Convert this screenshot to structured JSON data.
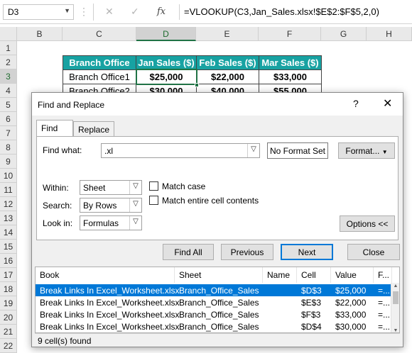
{
  "formula_bar": {
    "name_box": "D3",
    "formula": "=VLOOKUP(C3,Jan_Sales.xlsx!$E$2:$F$5,2,0)",
    "icons": [
      "more-options-icon",
      "cancel-icon",
      "confirm-icon",
      "function-icon"
    ]
  },
  "grid": {
    "columns": [
      "B",
      "C",
      "D",
      "E",
      "F",
      "G",
      "H"
    ],
    "rows": [
      "1",
      "2",
      "3",
      "4",
      "5",
      "6",
      "7",
      "8",
      "9",
      "10",
      "11",
      "12",
      "13",
      "14",
      "15",
      "16",
      "17",
      "18",
      "19",
      "20",
      "21",
      "22"
    ],
    "table": {
      "headers": [
        "Branch Office",
        "Jan Sales ($)",
        "Feb Sales ($)",
        "Mar Sales ($)"
      ],
      "rows": [
        [
          "Branch Office1",
          "$25,000",
          "$22,000",
          "$33,000"
        ],
        [
          "Branch Office2",
          "$30,000",
          "$40,000",
          "$55,000"
        ]
      ]
    },
    "colors": {
      "header_fill": "#17a2a2",
      "selection": "#217346"
    }
  },
  "dialog": {
    "title": "Find and Replace",
    "help": "?",
    "close": "✕",
    "tabs": [
      "Find",
      "Replace"
    ],
    "find_what_label": "Find what:",
    "find_what_value": ".xl",
    "no_format_label": "No Format Set",
    "format_label": "Format...",
    "within_label": "Within:",
    "within_value": "Sheet",
    "search_label": "Search:",
    "search_value": "By Rows",
    "look_in_label": "Look in:",
    "look_in_value": "Formulas",
    "match_case": "Match case",
    "match_entire": "Match entire cell contents",
    "options_label": "Options <<",
    "buttons": [
      "Find All",
      "Previous",
      "Next",
      "Close"
    ],
    "results": {
      "columns": [
        "Book",
        "Sheet",
        "Name",
        "Cell",
        "Value",
        "F..."
      ],
      "rows": [
        [
          "Break Links In Excel_Worksheet.xlsx",
          "Branch_Office_Sales",
          "",
          "$D$3",
          "$25,000",
          "=..."
        ],
        [
          "Break Links In Excel_Worksheet.xlsx",
          "Branch_Office_Sales",
          "",
          "$E$3",
          "$22,000",
          "=..."
        ],
        [
          "Break Links In Excel_Worksheet.xlsx",
          "Branch_Office_Sales",
          "",
          "$F$3",
          "$33,000",
          "=..."
        ],
        [
          "Break Links In Excel_Worksheet.xlsx",
          "Branch_Office_Sales",
          "",
          "$D$4",
          "$30,000",
          "=..."
        ]
      ]
    },
    "status": "9 cell(s) found",
    "accent": "#0078d7"
  }
}
